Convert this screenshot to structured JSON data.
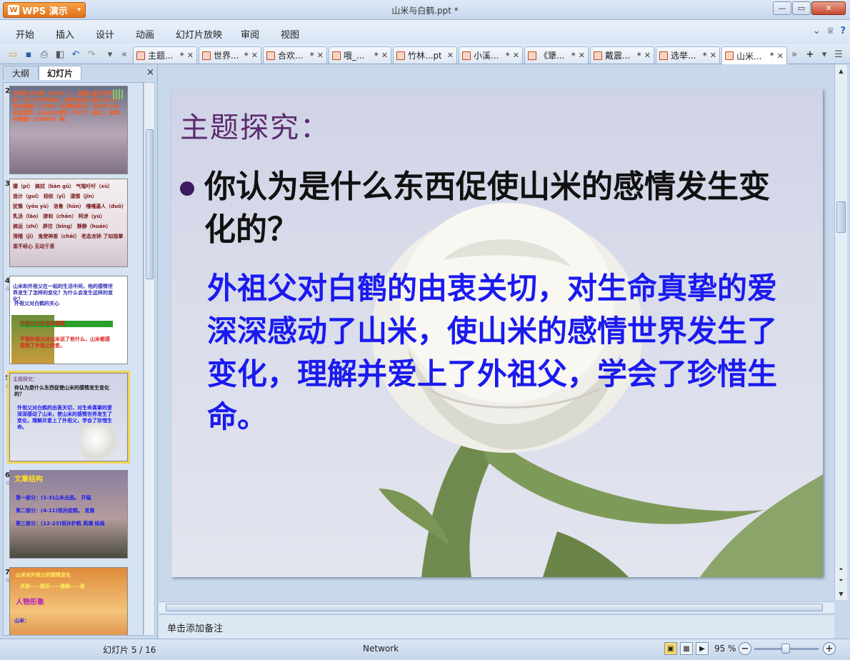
{
  "app": {
    "name": "WPS 演示",
    "window_title": "山米与白鹤.ppt *"
  },
  "window_controls": {
    "minimize": "—",
    "restore": "▭",
    "close": "✕"
  },
  "menu": [
    "开始",
    "插入",
    "设计",
    "动画",
    "幻灯片放映",
    "审阅",
    "视图"
  ],
  "menu_right": {
    "collapse": "⌄",
    "skin": "♕",
    "help": "?"
  },
  "toolbar_icons": [
    "open-icon",
    "save-icon",
    "print-icon",
    "preview-icon",
    "undo-icon",
    "redo-icon"
  ],
  "doc_tabs": [
    {
      "label": "主题...",
      "dirty": "*"
    },
    {
      "label": "世界...",
      "dirty": "*"
    },
    {
      "label": "合欢...",
      "dirty": "*"
    },
    {
      "label": "哦_...",
      "dirty": "*"
    },
    {
      "label": "竹林...pt",
      "dirty": ""
    },
    {
      "label": "小溪...",
      "dirty": "*"
    },
    {
      "label": "《犟...",
      "dirty": "*"
    },
    {
      "label": "戴震...",
      "dirty": "*"
    },
    {
      "label": "选举...",
      "dirty": "*"
    },
    {
      "label": "山米...",
      "dirty": "*"
    }
  ],
  "active_tab_index": 9,
  "left_panel": {
    "tab_outline": "大纲",
    "tab_slides": "幻灯片",
    "close": "×"
  },
  "thumbnails": [
    {
      "num": "2",
      "star": "",
      "lines": [
        "贝特西·贝尔斯（1928— ），美国儿童文学作家。生于北卡罗来纳。主要作品有儿童小说《午夜的狐狸》（1968）《天鹅的夏天》（获1971年纽伯瑞奖）《山米与白鹤》（1972）《缺之、和谐的难题》（1988年）等。"
      ]
    },
    {
      "num": "3",
      "star": "",
      "lines": [
        "獾（pí）  搞拭（bàn gū）  气喘吁吁（xū）",
        "诡计（guǐ）  相依（yī）  谨慎（jǐn）",
        "犹豫（yóu yù）  洛鲁（hūn）  嘎嘎逼人（duō）",
        "乳汤（lào）  掺和（chān）  阿谀（yú）",
        "搞运（zhí）  屏住（bǐng）  静静（huán）",
        "滑稽（jī）  鬼使神差（chāi）  老态龙钟  了如指掌",
        "滥不经心  无动于衷"
      ]
    },
    {
      "num": "4",
      "star": "☆",
      "lines": [
        "山米和外祖父在一起的生活中间，他的感情世界发生了怎样的变化？为什么会发生这样的变化？",
        "外祖父对白鹤的关心",
        "外祖父对生命的尊重",
        "不管外祖父对山米说了些什么，山米都感受到了外祖父的爱。"
      ]
    },
    {
      "num": "5",
      "star": "☆",
      "lines": [
        "主题探究：",
        "你认为是什么东西促使山米的感情发生变化的？",
        "外祖父对白鹤的由衷关切，对生命真挚的爱深深感动了山米，使山米的感情世界发生了变化，理解并爱上了外祖父，学会了珍惜生命。"
      ]
    },
    {
      "num": "6",
      "star": "☆",
      "lines": [
        "文章结构",
        "第一部分：(1-3)山米出逃。    开端",
        "第二部分：(4-11)祖孙捉鹤。    发展",
        "第三部分：(12-23)祖孙护鹤     高潮   结局"
      ]
    },
    {
      "num": "7",
      "star": "☆",
      "lines": [
        "山米对外祖父的感情变化",
        "厌恶——接近——理解——爱",
        "人物形象",
        "山米："
      ]
    }
  ],
  "slide": {
    "title": "主题探究：",
    "question": "你认为是什么东西促使山米的感情发生变化的？",
    "answer": "外祖父对白鹤的由衷关切，对生命真挚的爱深深感动了山米，使山米的感情世界发生了变化，理解并爱上了外祖父，学会了珍惜生命。",
    "colors": {
      "title": "#5b2a6e",
      "question": "#111111",
      "answer": "#1a1af0",
      "bullet": "#3b1a60"
    }
  },
  "notes_placeholder": "单击添加备注",
  "status": {
    "slide_counter": "幻灯片 5 / 16",
    "template": "Network",
    "zoom_label": "95 %",
    "zoom_value": 95
  }
}
